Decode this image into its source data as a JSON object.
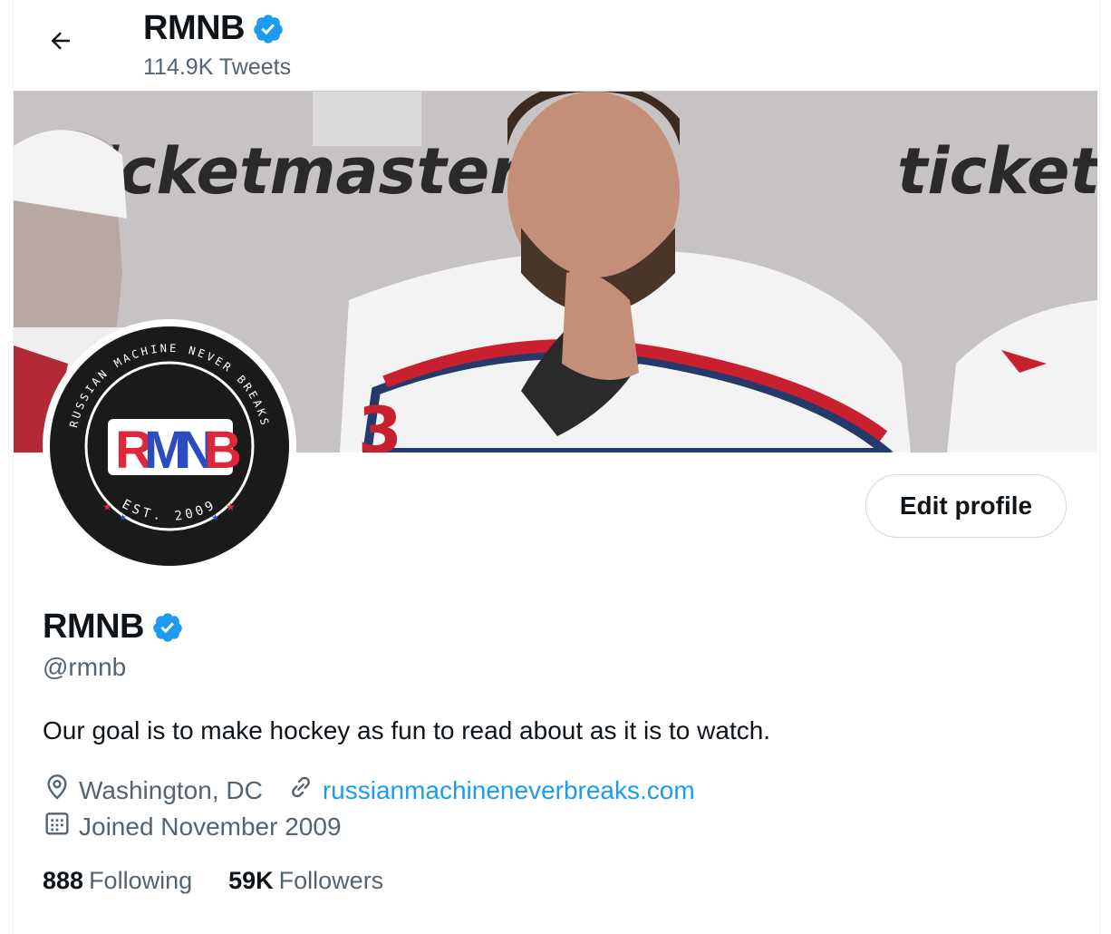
{
  "header": {
    "title": "RMNB",
    "tweet_count": "114.9K Tweets",
    "back_icon": "arrow-left-icon"
  },
  "banner": {
    "sponsor_text_left": "icketmaster",
    "sponsor_text_right": "ticketr",
    "jersey_number": "3"
  },
  "avatar": {
    "ring_text_top": "RUSSIAN MACHINE NEVER BREAKS",
    "logo_letters": [
      "R",
      "M",
      "N",
      "B"
    ],
    "ring_text_bottom": "EST. 2009",
    "colors": {
      "red": "#e0263a",
      "blue": "#2b4cbf",
      "black": "#1a1a1a"
    }
  },
  "actions": {
    "edit_profile_label": "Edit profile"
  },
  "profile": {
    "name": "RMNB",
    "handle": "@rmnb",
    "bio": "Our goal is to make hockey as fun to read about as it is to watch.",
    "location": "Washington, DC",
    "website": "russianmachineneverbreaks.com",
    "joined": "Joined November 2009",
    "verified_color": "#1d9bf0"
  },
  "stats": {
    "following_count": "888",
    "following_label": "Following",
    "followers_count": "59K",
    "followers_label": "Followers"
  }
}
